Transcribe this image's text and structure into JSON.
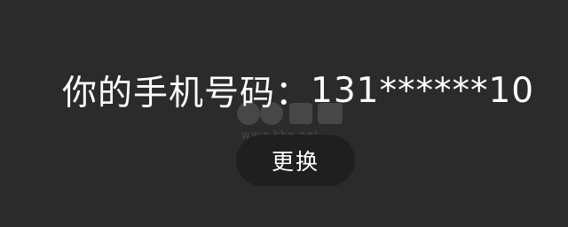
{
  "phone": {
    "label": "你的手机号码：",
    "number": "131******10"
  },
  "watermark": {
    "url": "www.kkx.net"
  },
  "actions": {
    "change_label": "更换"
  }
}
